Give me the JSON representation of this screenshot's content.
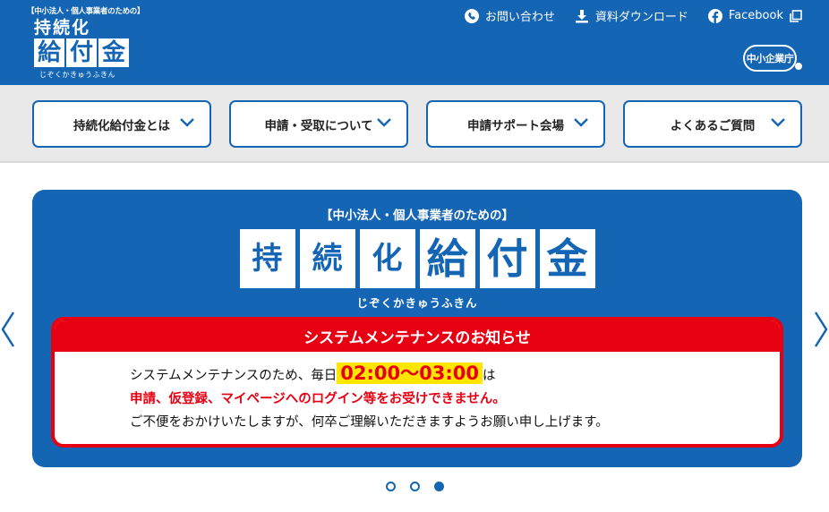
{
  "logo": {
    "tagline": "【中小法人・個人事業者のための】",
    "row1": [
      "持",
      "続",
      "化"
    ],
    "row2": [
      "給",
      "付",
      "金"
    ],
    "kana": "じぞくかきゅうふきん"
  },
  "toplinks": [
    {
      "label": "お問い合わせ",
      "icon": "phone-icon"
    },
    {
      "label": "資料ダウンロード",
      "icon": "download-icon"
    },
    {
      "label": "Facebook",
      "icon": "facebook-icon"
    }
  ],
  "agency_logo": "中小企業庁",
  "nav": [
    {
      "label": "持続化給付金とは"
    },
    {
      "label": "申請・受取について"
    },
    {
      "label": "申請サポート会場"
    },
    {
      "label": "よくあるご質問"
    }
  ],
  "hero": {
    "subtitle": "【中小法人・個人事業者のための】",
    "title_chars": [
      "持",
      "続",
      "化",
      "給",
      "付",
      "金"
    ],
    "kana": "じぞくかきゅうふきん"
  },
  "notice": {
    "heading": "システムメンテナンスのお知らせ",
    "line1_prefix": "システムメンテナンスのため、毎日",
    "time": "02:00～03:00",
    "line1_suffix": "は",
    "line2": "申請、仮登録、マイページへのログイン等をお受けできません。",
    "line3": "ご不便をおかけいたしますが、何卒ご理解いただきますようお願い申し上げます。"
  },
  "carousel": {
    "slides": 3,
    "active": 3
  },
  "colors": {
    "brand_blue": "#1565b5",
    "alert_red": "#e60012",
    "highlight_yellow": "#ffe500",
    "nav_bg": "#e9e9e9"
  }
}
